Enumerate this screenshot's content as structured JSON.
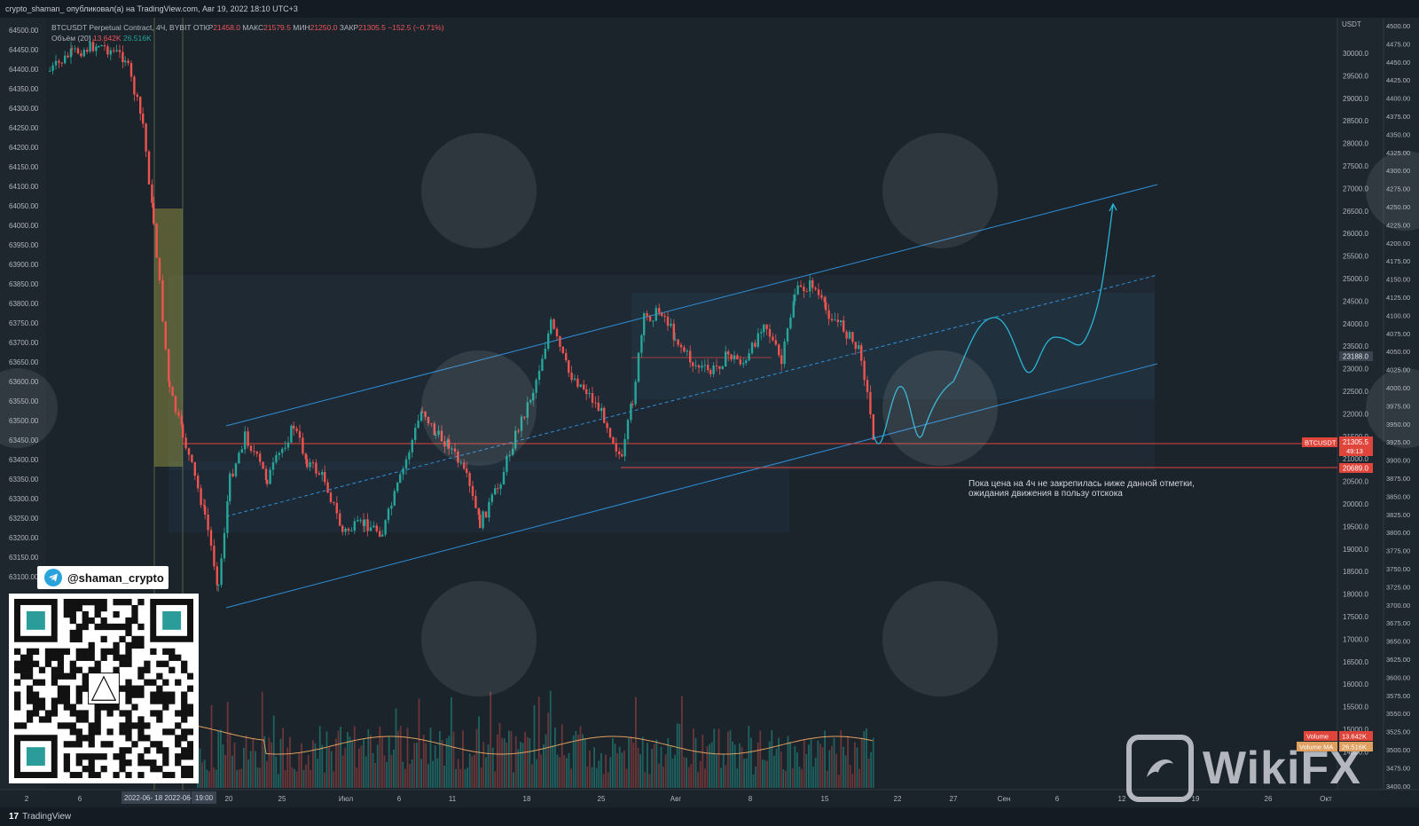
{
  "window": {
    "title": "crypto_shaman_ опубликовал(а) на TradingView.com, Авг 19, 2022 18:10 UTC+3"
  },
  "legend": {
    "symbol": "BTCUSDT Perpetual Contract, 4Ч, BYBIT",
    "open_label": "ОТКР",
    "open": "21458.0",
    "high_label": "МАКС",
    "high": "21579.5",
    "low_label": "МИН",
    "low": "21250.0",
    "close_label": "ЗАКР",
    "close": "21305.5",
    "change": "−152.5 (−0.71%)",
    "volume_label": "Объём (20)",
    "volume_value": "13.642K",
    "volume_ma": "26.516K"
  },
  "annotation": {
    "line1": "Пока цена на 4ч не закрепилась ниже данной отметки,",
    "line2": "ожидания движения в пользу отскока"
  },
  "telegram": {
    "handle": "@shaman_crypto"
  },
  "left_axis": {
    "ticks": [
      "64500.00",
      "64450.00",
      "64400.00",
      "64350.00",
      "64300.00",
      "64250.00",
      "64200.00",
      "64150.00",
      "64100.00",
      "64050.00",
      "64000.00",
      "63950.00",
      "63900.00",
      "63850.00",
      "63800.00",
      "63750.00",
      "63700.00",
      "63650.00",
      "63600.00",
      "63550.00",
      "63500.00",
      "63450.00",
      "63400.00",
      "63350.00",
      "63300.00",
      "63250.00",
      "63200.00",
      "63150.00",
      "63100.00"
    ]
  },
  "right_axis_1": {
    "currency": "USDT",
    "ticks": [
      "30000.0",
      "29500.0",
      "29000.0",
      "28500.0",
      "28000.0",
      "27500.0",
      "27000.0",
      "26500.0",
      "26000.0",
      "25500.0",
      "25000.0",
      "24500.0",
      "24000.0",
      "23500.0",
      "23000.0",
      "22500.0",
      "22000.0",
      "21500.0",
      "21000.0",
      "20500.0",
      "20000.0",
      "19500.0",
      "19000.0",
      "18500.0",
      "18000.0",
      "17500.0",
      "17000.0",
      "16500.0",
      "16000.0",
      "15500.0",
      "15000.0",
      "14000.0"
    ],
    "marker_23188": "23188.0",
    "marker_symbol": "BTCUSDT",
    "marker_price": "21305.5",
    "marker_countdown": "49:13",
    "marker_20689": "20689.0",
    "volume_badge": "Volume",
    "volume_badge_val": "13.642K",
    "volume_ma_badge": "Volume MA",
    "volume_ma_badge_val": "26.516K"
  },
  "right_axis_2": {
    "ticks": [
      "4500.00",
      "4475.00",
      "4450.00",
      "4425.00",
      "4400.00",
      "4375.00",
      "4350.00",
      "4325.00",
      "4300.00",
      "4275.00",
      "4250.00",
      "4225.00",
      "4200.00",
      "4175.00",
      "4150.00",
      "4125.00",
      "4100.00",
      "4075.00",
      "4050.00",
      "4025.00",
      "4000.00",
      "3975.00",
      "3950.00",
      "3925.00",
      "3900.00",
      "3875.00",
      "3850.00",
      "3825.00",
      "3800.00",
      "3775.00",
      "3750.00",
      "3725.00",
      "3700.00",
      "3675.00",
      "3650.00",
      "3625.00",
      "3600.00",
      "3575.00",
      "3550.00",
      "3525.00",
      "3500.00",
      "3475.00",
      "3400.00"
    ]
  },
  "time_axis": {
    "ticks": [
      "2",
      "6",
      "20",
      "25",
      "Июл",
      "6",
      "11",
      "18",
      "25",
      "Авг",
      "8",
      "15",
      "22",
      "27",
      "Сен",
      "6",
      "12",
      "19",
      "26",
      "Окт"
    ],
    "highlight_left": "2022-06-  18  2022-06-15",
    "highlight_right": "19:00"
  },
  "footer": {
    "brand": "TradingView"
  },
  "watermark": {
    "text": "WikiFX"
  },
  "colors": {
    "up": "#26a69a",
    "down": "#ef5350",
    "channel": "#2e8fd8",
    "forecast": "#29b6d6",
    "level": "#e0453c",
    "zone": "#c9c74a"
  }
}
